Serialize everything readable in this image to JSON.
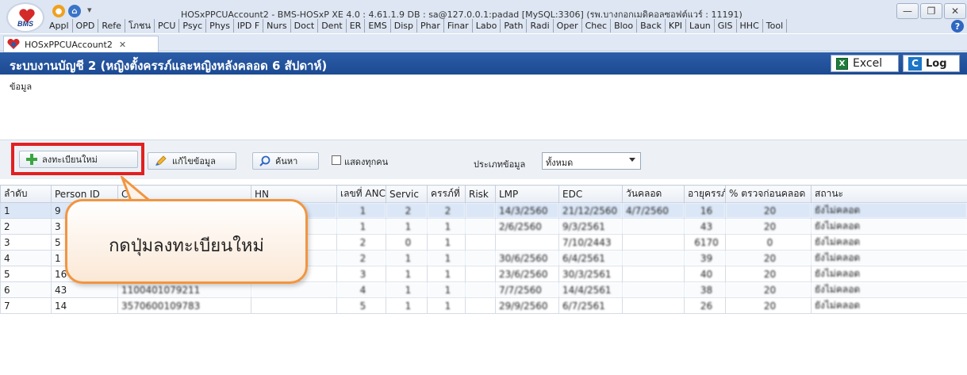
{
  "window": {
    "title": "HOSxPPCUAccount2 - BMS-HOSxP XE 4.0 : 4.61.1.9 DB : sa@127.0.0.1:padad [MySQL:3306] (รพ.บางกอกเมดิคอลซอฟต์แวร์ : 11191)",
    "logo_text": "BMS",
    "minimize": "—",
    "maximize": "❐",
    "close": "✕"
  },
  "menu": [
    "Appl",
    "OPD",
    "Refe",
    "โภชน",
    "PCU",
    "Psyc",
    "Phys",
    "IPD F",
    "Nurs",
    "Doct",
    "Dent",
    "ER",
    "EMS",
    "Disp",
    "Phar",
    "Finar",
    "Labo",
    "Path",
    "Radi",
    "Oper",
    "Chec",
    "Bloo",
    "Back",
    "KPI",
    "Laun",
    "GIS",
    "HHC",
    "Tool"
  ],
  "help": "?",
  "tab": {
    "label": "HOSxPPCUAccount2",
    "close": "✕"
  },
  "header": {
    "title": "ระบบงานบัญชี 2 (หญิงตั้งครรภ์และหญิงหลังคลอด 6 สัปดาห์)",
    "excel": "Excel",
    "excel_icon": "X",
    "log": "Log",
    "log_icon": "C"
  },
  "submenu": "ข้อมูล",
  "toolbar": {
    "add": "ลงทะเบียนใหม่",
    "edit": "แก้ไขข้อมูล",
    "search": "ค้นหา",
    "show_all": "แสดงทุกคน",
    "type_label": "ประเภทข้อมูล",
    "type_value": "ทั้งหมด"
  },
  "grid": {
    "columns": [
      "ลำดับ",
      "Person ID",
      "CID",
      "HN",
      "เลขที่ ANC",
      "Servic",
      "ครรภ์ที่",
      "Risk",
      "LMP",
      "EDC",
      "วันคลอด",
      "อายุครรภ์",
      "% ตรวจก่อนคลอด",
      "สถานะ"
    ],
    "rows": [
      [
        "1",
        "9",
        "",
        "",
        "1",
        "2",
        "2",
        "",
        "14/3/2560",
        "21/12/2560",
        "4/7/2560",
        "16",
        "20",
        "ยังไม่คลอด"
      ],
      [
        "2",
        "3",
        "",
        "",
        "1",
        "1",
        "1",
        "",
        "2/6/2560",
        "9/3/2561",
        "",
        "43",
        "20",
        "ยังไม่คลอด"
      ],
      [
        "3",
        "5",
        "",
        "",
        "2",
        "0",
        "1",
        "",
        "",
        "7/10/2443",
        "",
        "6170",
        "0",
        "ยังไม่คลอด"
      ],
      [
        "4",
        "1",
        "",
        "",
        "2",
        "1",
        "1",
        "",
        "30/6/2560",
        "6/4/2561",
        "",
        "39",
        "20",
        "ยังไม่คลอด"
      ],
      [
        "5",
        "16",
        "3570600023?879",
        "",
        "3",
        "1",
        "1",
        "",
        "23/6/2560",
        "30/3/2561",
        "",
        "40",
        "20",
        "ยังไม่คลอด"
      ],
      [
        "6",
        "43",
        "1100401079211",
        "",
        "4",
        "1",
        "1",
        "",
        "7/7/2560",
        "14/4/2561",
        "",
        "38",
        "20",
        "ยังไม่คลอด"
      ],
      [
        "7",
        "14",
        "3570600109783",
        "",
        "5",
        "1",
        "1",
        "",
        "29/9/2560",
        "6/7/2561",
        "",
        "26",
        "20",
        "ยังไม่คลอด"
      ]
    ]
  },
  "callout": "กดปุ่มลงทะเบียนใหม่",
  "colors": {
    "accent": "#1c4a92",
    "highlight": "#e22020",
    "callout_border": "#f29540"
  }
}
